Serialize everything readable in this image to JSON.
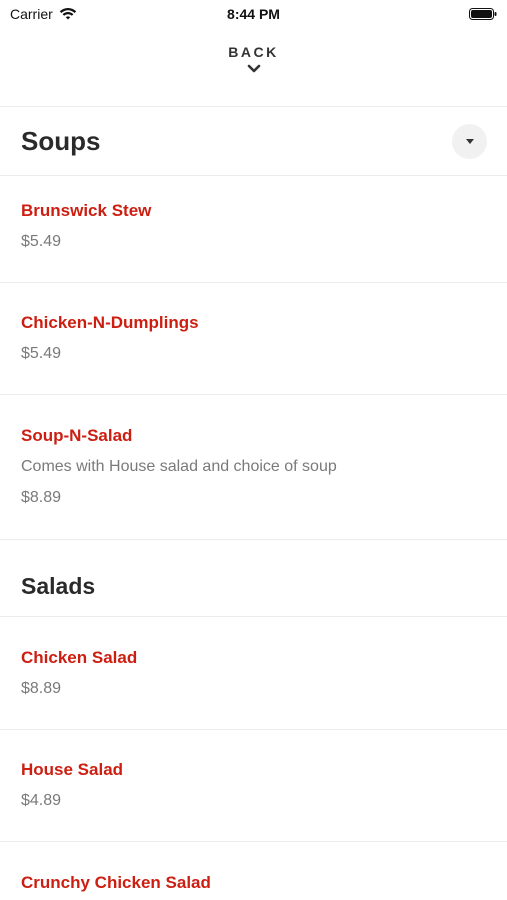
{
  "status_bar": {
    "carrier": "Carrier",
    "time": "8:44 PM"
  },
  "nav": {
    "back_label": "BACK"
  },
  "colors": {
    "item_name": "#cc1f12",
    "price_text": "#7a7a7a"
  },
  "sections": [
    {
      "title": "Soups",
      "items": [
        {
          "name": "Brunswick Stew",
          "price": "$5.49"
        },
        {
          "name": "Chicken-N-Dumplings",
          "price": "$5.49"
        },
        {
          "name": "Soup-N-Salad",
          "description": "Comes with House salad and choice of soup",
          "price": "$8.89"
        }
      ]
    },
    {
      "title": "Salads",
      "items": [
        {
          "name": "Chicken Salad",
          "price": "$8.89"
        },
        {
          "name": "House Salad",
          "price": "$4.89"
        },
        {
          "name": "Crunchy Chicken Salad"
        }
      ]
    }
  ]
}
